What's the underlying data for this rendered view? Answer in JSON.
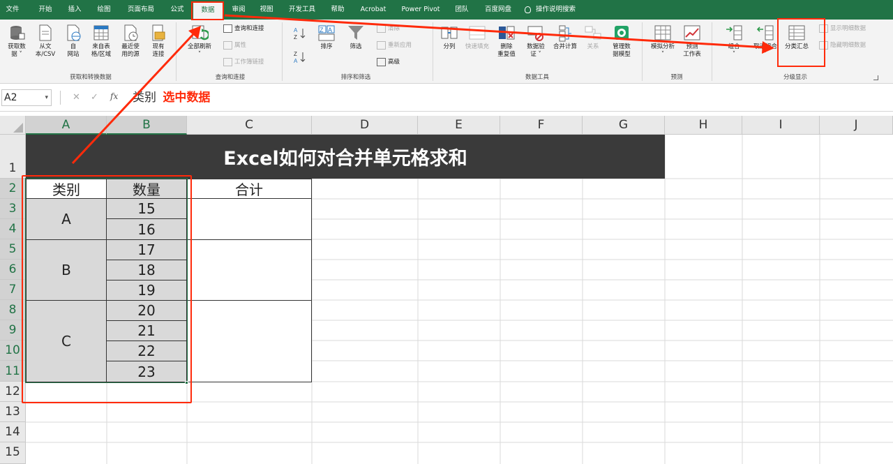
{
  "tabs": [
    "文件",
    "开始",
    "插入",
    "绘图",
    "页面布局",
    "公式",
    "数据",
    "审阅",
    "视图",
    "开发工具",
    "帮助",
    "Acrobat",
    "Power Pivot",
    "团队",
    "百度网盘",
    "操作说明搜索"
  ],
  "ribbon": {
    "get_data": {
      "label": "获取和转换数据",
      "buttons": [
        "获取数\n据 ˅",
        "从文\n本/CSV",
        "自\n网站",
        "来自表\n格/区域",
        "最近使\n用的源",
        "现有\n连接"
      ]
    },
    "queries": {
      "label": "查询和连接",
      "refresh_all": "全部刷新\n˅",
      "small": [
        "查询和连接",
        "属性",
        "工作簿链接"
      ]
    },
    "sort_filter": {
      "label": "排序和筛选",
      "sort": "排序",
      "filter": "筛选",
      "small": [
        "清除",
        "重新应用",
        "高级"
      ]
    },
    "data_tools": {
      "label": "数据工具",
      "buttons": [
        "分列",
        "快速填充",
        "删除\n重复值",
        "数据验\n证 ˅",
        "合并计算",
        "关系",
        "管理数\n据模型"
      ]
    },
    "forecast": {
      "label": "预测",
      "buttons": [
        "模拟分析\n˅",
        "预测\n工作表"
      ]
    },
    "outline": {
      "label": "分级显示",
      "buttons": [
        "组合\n˅",
        "取消组合\n˅",
        "分类汇总"
      ],
      "small": [
        "显示明细数据",
        "隐藏明细数据"
      ]
    }
  },
  "formula_bar": {
    "name_box": "A2",
    "content": "类别",
    "annotation": "选中数据"
  },
  "columns": [
    "A",
    "B",
    "C",
    "D",
    "E",
    "F",
    "G",
    "H",
    "I",
    "J"
  ],
  "rows": [
    "1",
    "2",
    "3",
    "4",
    "5",
    "6",
    "7",
    "8",
    "9",
    "10",
    "11",
    "12",
    "13",
    "14",
    "15"
  ],
  "sheet": {
    "title": "Excel如何对合并单元格求和",
    "headers": [
      "类别",
      "数量",
      "合计"
    ],
    "categories": [
      "A",
      "B",
      "C"
    ],
    "quantities": [
      "15",
      "16",
      "17",
      "18",
      "19",
      "20",
      "21",
      "22",
      "23"
    ]
  },
  "colors": {
    "accent": "#217346",
    "annotation": "#ff2a0a",
    "title_bg": "#3a3a3a",
    "selection_fill": "#d9d9d9"
  }
}
